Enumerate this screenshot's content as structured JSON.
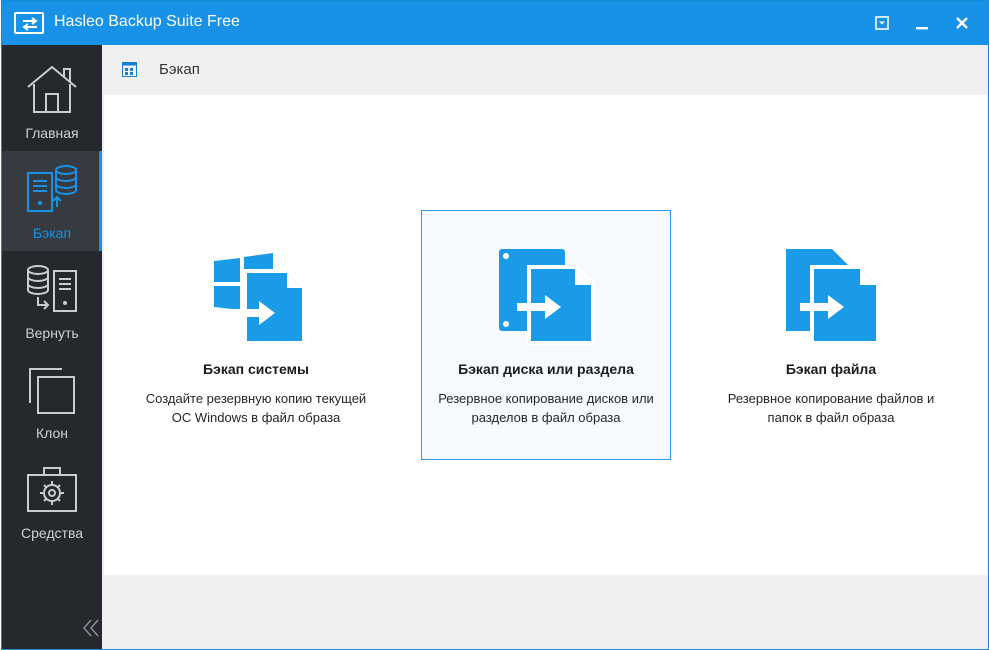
{
  "window": {
    "title": "Hasleo Backup Suite Free"
  },
  "breadcrumb": {
    "label": "Бэкап"
  },
  "sidebar": {
    "items": [
      {
        "label": "Главная",
        "icon": "home-icon"
      },
      {
        "label": "Бэкап",
        "icon": "backup-icon",
        "active": true
      },
      {
        "label": "Вернуть",
        "icon": "restore-icon"
      },
      {
        "label": "Клон",
        "icon": "clone-icon"
      },
      {
        "label": "Средства",
        "icon": "toolbox-icon"
      }
    ],
    "collapse_icon": "double-chevron-left-icon"
  },
  "cards": [
    {
      "title": "Бэкап системы",
      "desc": "Создайте резервную копию текущей ОС Windows в файл образа",
      "icon": "system-backup-icon"
    },
    {
      "title": "Бэкап диска или раздела",
      "desc": "Резервное копирование дисков или разделов в файл образа",
      "icon": "disk-backup-icon",
      "selected": true
    },
    {
      "title": "Бэкап файла",
      "desc": "Резервное копирование файлов и папок в файл образа",
      "icon": "file-backup-icon"
    }
  ],
  "colors": {
    "accent": "#1892e6",
    "sidebar_bg": "#25282d",
    "icon_blue": "#1a9be8"
  }
}
